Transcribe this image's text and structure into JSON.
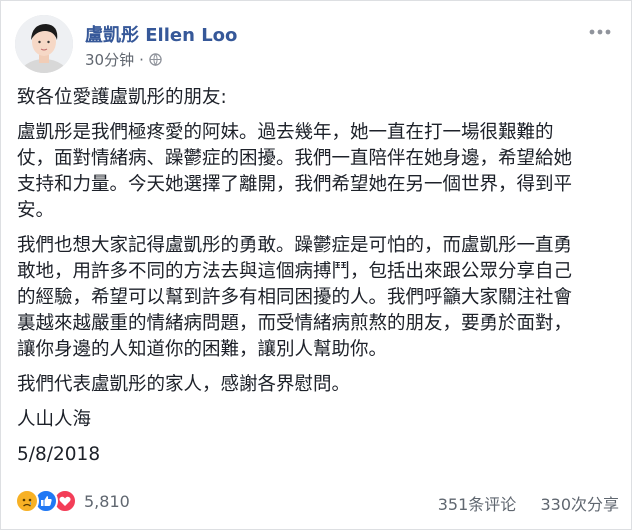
{
  "post": {
    "author": "盧凱彤 Ellen Loo",
    "timestamp": "30分钟",
    "separator": "·",
    "privacy_icon": "globe-icon",
    "more_icon": "more-options-icon",
    "paragraphs": [
      [
        "致各位愛護盧凱彤的朋友:"
      ],
      [
        "盧凱彤是我們極疼愛的阿妹。過去幾年，她一直在打一場很艱難的",
        "仗，面對情緒病、躁鬱症的困擾。我們一直陪伴在她身邊，希望給她",
        "支持和力量。今天她選擇了離開，我們希望她在另一個世界，得到平",
        "安。"
      ],
      [
        "我們也想大家記得盧凱彤的勇敢。躁鬱症是可怕的，而盧凱彤一直勇",
        "敢地，用許多不同的方法去與這個病搏鬥，包括出來跟公眾分享自己",
        "的經驗，希望可以幫到許多有相同困擾的人。我們呼籲大家關注社會",
        "裏越來越嚴重的情緒病問題，而受情緒病煎熬的朋友，要勇於面對，",
        "讓你身邊的人知道你的困難，讓別人幫助你。"
      ],
      [
        "我們代表盧凱彤的家人，感謝各界慰問。"
      ],
      [
        "人山人海"
      ],
      [
        "5/8/2018"
      ]
    ]
  },
  "footer": {
    "reaction_icons": [
      "sad-reaction-icon",
      "like-reaction-icon",
      "love-reaction-icon"
    ],
    "reaction_count": "5,810",
    "comments": "351条评论",
    "shares": "330次分享"
  },
  "colors": {
    "link": "#365899",
    "meta": "#616770",
    "like": "#2078f4",
    "love": "#f33e58",
    "sad": "#f7b125"
  }
}
